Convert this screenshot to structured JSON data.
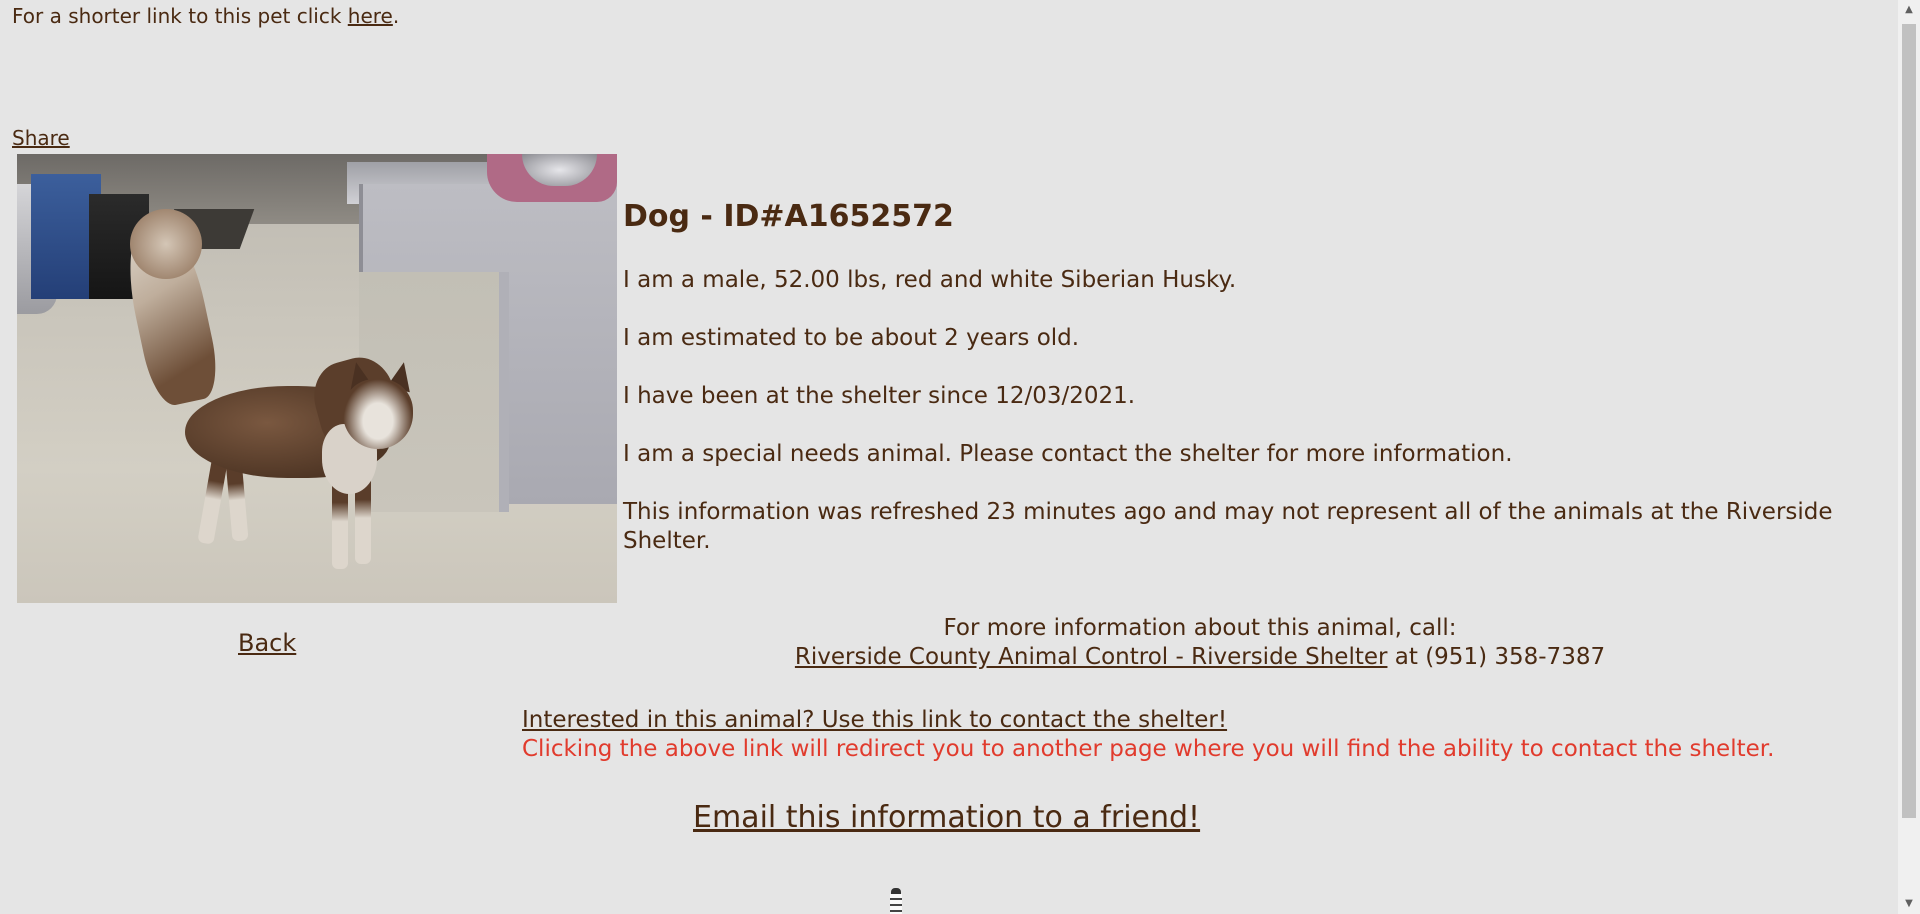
{
  "header": {
    "shorter_link_prefix": "For a shorter link to this pet click ",
    "shorter_link_label": "here",
    "shorter_link_suffix": ".",
    "share_label": "Share"
  },
  "animal": {
    "title": "Dog - ID#A1652572",
    "description": "I am a male, 52.00 lbs, red and white Siberian Husky.",
    "age": "I am estimated to be about 2 years old.",
    "since": "I have been at the shelter since 12/03/2021.",
    "special_needs": "I am a special needs animal. Please contact the shelter for more information.",
    "refresh_note": "This information was refreshed 23 minutes ago and may not represent all of the animals at the Riverside Shelter."
  },
  "nav": {
    "back_label": "Back"
  },
  "call": {
    "intro": "For more information about this animal, call:",
    "shelter_link": "Riverside County Animal Control - Riverside Shelter",
    "phone_text": " at (951) 358-7387"
  },
  "contact": {
    "link_label": "Interested in this animal? Use this link to contact the shelter!",
    "warning": "Clicking the above link will redirect you to another page where you will find the ability to contact the shelter."
  },
  "email": {
    "label": "Email this information to a friend!"
  },
  "colors": {
    "background": "#e5e5e5",
    "text": "#4a2a12",
    "warning": "#e13b2d"
  },
  "icons": {
    "logo": "lighthouse-icon",
    "scroll_up": "triangle-up-icon",
    "scroll_down": "triangle-down-icon"
  }
}
